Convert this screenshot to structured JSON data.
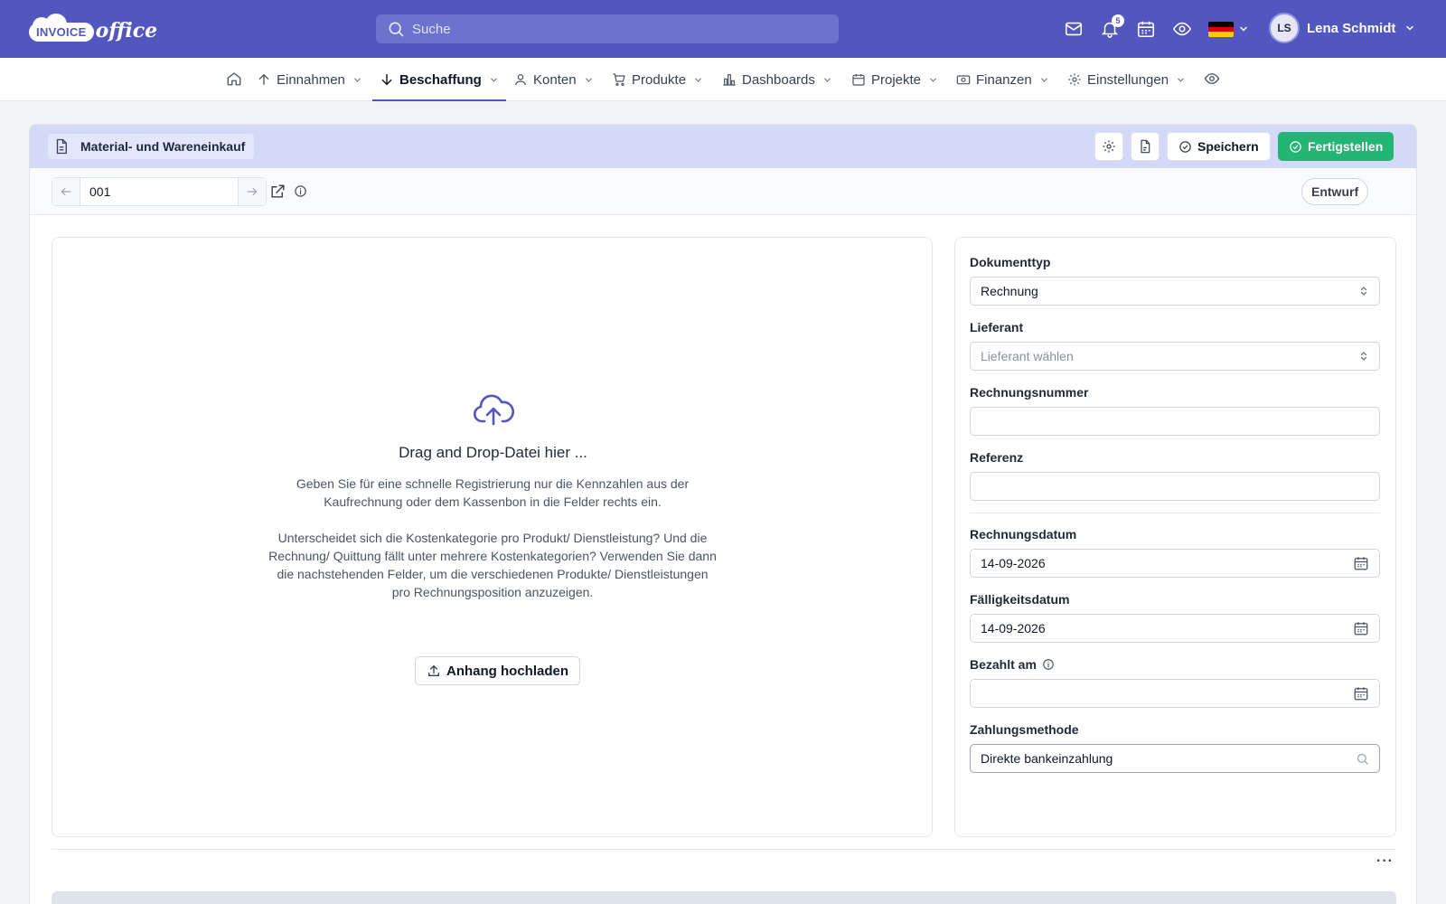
{
  "app": {
    "logo_text": "INVOICE office"
  },
  "header": {
    "search_placeholder": "Suche",
    "notification_count": "5",
    "user": {
      "initials": "LS",
      "name": "Lena Schmidt"
    },
    "language_flag": "de",
    "flag_colors": [
      "#000000",
      "#dd0000",
      "#ffce00"
    ]
  },
  "nav": {
    "items": [
      {
        "label": "Einnahmen",
        "icon": "arrow-up-icon"
      },
      {
        "label": "Beschaffung",
        "icon": "arrow-down-icon",
        "active": true
      },
      {
        "label": "Konten",
        "icon": "user-icon"
      },
      {
        "label": "Produkte",
        "icon": "cart-icon"
      },
      {
        "label": "Dashboards",
        "icon": "bar-chart-icon"
      },
      {
        "label": "Projekte",
        "icon": "calendar-icon"
      },
      {
        "label": "Finanzen",
        "icon": "money-icon"
      },
      {
        "label": "Einstellungen",
        "icon": "gear-icon"
      }
    ]
  },
  "document": {
    "title": "Material- und Wareneinkauf",
    "save_label": "Speichern",
    "finish_label": "Fertigstellen",
    "number": "001",
    "status": "Entwurf"
  },
  "upload": {
    "title": "Drag and Drop-Datei hier ...",
    "text1": "Geben Sie für eine schnelle Registrierung nur die Kennzahlen aus der Kaufrechnung oder dem Kassenbon in die Felder rechts ein.",
    "text2": "Unterscheidet sich die Kostenkategorie pro Produkt/ Dienstleistung? Und die Rechnung/ Quittung fällt unter mehrere Kostenkategorien? Verwenden Sie dann die nachstehenden Felder, um die verschiedenen Produkte/ Dienstleistungen pro Rechnungsposition anzuzeigen.",
    "button_label": "Anhang hochladen"
  },
  "form": {
    "doc_type_label": "Dokumenttyp",
    "doc_type_value": "Rechnung",
    "supplier_label": "Lieferant",
    "supplier_placeholder": "Lieferant wählen",
    "invoice_number_label": "Rechnungsnummer",
    "invoice_number_value": "",
    "reference_label": "Referenz",
    "reference_value": "",
    "invoice_date_label": "Rechnungsdatum",
    "invoice_date_value": "14-09-2026",
    "due_date_label": "Fälligkeitsdatum",
    "due_date_value": "14-09-2026",
    "paid_on_label": "Bezahlt am",
    "paid_on_value": "",
    "payment_method_label": "Zahlungsmethode",
    "payment_method_value": "Direkte bankeinzahlung"
  },
  "colors": {
    "brand": "#5157bf",
    "success": "#22b573",
    "card_header": "#d4d9f7"
  }
}
